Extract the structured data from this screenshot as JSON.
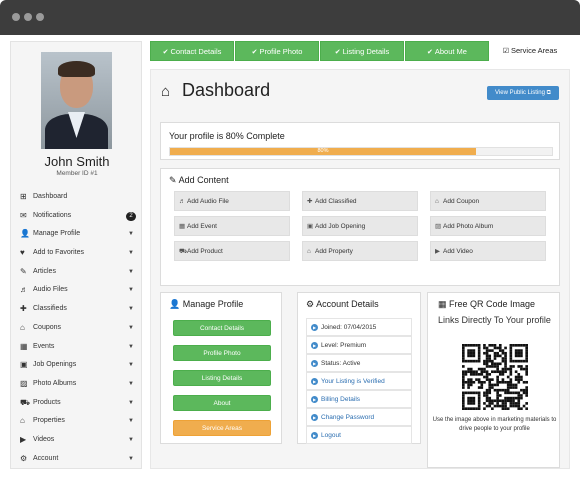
{
  "sidebar": {
    "name": "John Smith",
    "member_id": "Member ID #1",
    "items": [
      {
        "label": "Dashboard",
        "icon": "dashboard-icon",
        "glyph": "⊞"
      },
      {
        "label": "Notifications",
        "icon": "envelope-icon",
        "glyph": "✉",
        "badge": "2"
      },
      {
        "label": "Manage Profile",
        "icon": "user-icon",
        "glyph": "👤"
      },
      {
        "label": "Add to Favorites",
        "icon": "heart-icon",
        "glyph": "♥"
      },
      {
        "label": "Articles",
        "icon": "pencil-icon",
        "glyph": "✎"
      },
      {
        "label": "Audio Files",
        "icon": "audio-icon",
        "glyph": "♬"
      },
      {
        "label": "Classifieds",
        "icon": "pushpin-icon",
        "glyph": "✚"
      },
      {
        "label": "Coupons",
        "icon": "tag-icon",
        "glyph": "⌂"
      },
      {
        "label": "Events",
        "icon": "calendar-icon",
        "glyph": "▦"
      },
      {
        "label": "Job Openings",
        "icon": "briefcase-icon",
        "glyph": "▣"
      },
      {
        "label": "Photo Albums",
        "icon": "photo-icon",
        "glyph": "▨"
      },
      {
        "label": "Products",
        "icon": "cart-icon",
        "glyph": "⛟"
      },
      {
        "label": "Properties",
        "icon": "home-icon",
        "glyph": "⌂"
      },
      {
        "label": "Videos",
        "icon": "video-icon",
        "glyph": "▶"
      },
      {
        "label": "Account",
        "icon": "gear-icon",
        "glyph": "⚙"
      }
    ]
  },
  "tabs": [
    {
      "label": "Contact Details",
      "checked": true
    },
    {
      "label": "Profile Photo",
      "checked": true
    },
    {
      "label": "Listing Details",
      "checked": true
    },
    {
      "label": "About Me",
      "checked": true
    },
    {
      "label": "Service Areas",
      "checked": false
    }
  ],
  "dashboard": {
    "title": "Dashboard",
    "public_listing_button": "View Public Listing",
    "profile_complete_text": "Your profile is 80% Complete",
    "progress_label": "80%",
    "progress": 0.8
  },
  "add_content": {
    "title": "Add Content",
    "buttons": [
      {
        "label": "Add Audio File",
        "icon": "audio-icon",
        "glyph": "♬"
      },
      {
        "label": "Add Classified",
        "icon": "pushpin-icon",
        "glyph": "✚"
      },
      {
        "label": "Add Coupon",
        "icon": "tag-icon",
        "glyph": "⌂"
      },
      {
        "label": "Add Event",
        "icon": "calendar-icon",
        "glyph": "▦"
      },
      {
        "label": "Add Job Opening",
        "icon": "briefcase-icon",
        "glyph": "▣"
      },
      {
        "label": "Add Photo Album",
        "icon": "photo-icon",
        "glyph": "▨"
      },
      {
        "label": "Add Product",
        "icon": "cart-icon",
        "glyph": "⛟"
      },
      {
        "label": "Add Property",
        "icon": "home-icon",
        "glyph": "⌂"
      },
      {
        "label": "Add Video",
        "icon": "video-icon",
        "glyph": "▶"
      }
    ]
  },
  "manage_profile": {
    "title": "Manage Profile",
    "buttons": [
      {
        "label": "Contact Details",
        "color": "#5cb85c"
      },
      {
        "label": "Profile Photo",
        "color": "#5cb85c"
      },
      {
        "label": "Listing Details",
        "color": "#5cb85c"
      },
      {
        "label": "About",
        "color": "#5cb85c"
      },
      {
        "label": "Service Areas",
        "color": "#f0ad4e"
      }
    ]
  },
  "account_details": {
    "title": "Account Details",
    "rows": [
      {
        "label": "Joined: 07/04/2015",
        "link": false
      },
      {
        "label": "Level: Premium",
        "link": false
      },
      {
        "label": "Status: Active",
        "link": false
      },
      {
        "label": "Your Listing is Verified",
        "link": true
      },
      {
        "label": "Billing Details",
        "link": true
      },
      {
        "label": "Change Password",
        "link": true
      },
      {
        "label": "Logout",
        "link": true
      }
    ]
  },
  "qr": {
    "title": "Free QR Code Image",
    "heading": "Links Directly To Your profile",
    "note": "Use the image above in marketing materials to drive people to your profile"
  },
  "colors": {
    "green": "#5cb85c",
    "orange": "#f0ad4e",
    "blue": "#428bca",
    "chrome": "#3d3d3d"
  }
}
